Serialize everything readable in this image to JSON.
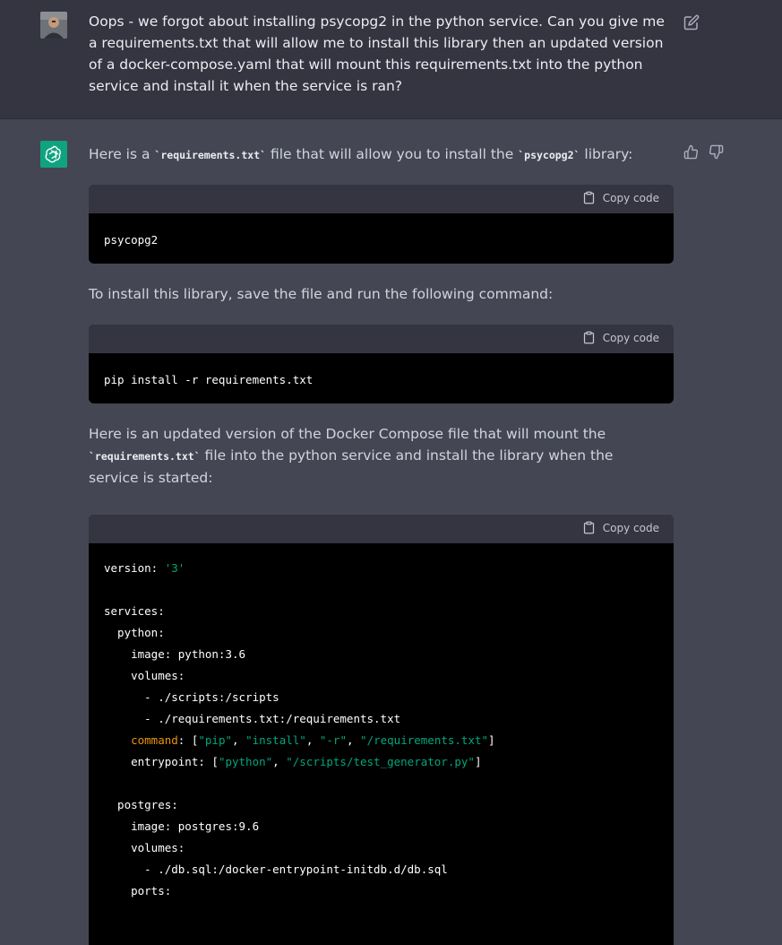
{
  "user_message": {
    "text": "Oops - we forgot about installing psycopg2 in the python service. Can you give me a requirements.txt that will allow me to install this library then an updated version of a docker-compose.yaml that will mount this requirements.txt into the python service and install it when the service is ran?"
  },
  "assistant": {
    "p1_before": "Here is a ",
    "p1_code1": "`requirements.txt`",
    "p1_middle": " file that will allow you to install the ",
    "p1_code2": "`psycopg2`",
    "p1_after": " library:",
    "code1": "psycopg2",
    "p2": "To install this library, save the file and run the following command:",
    "code2": "pip install -r requirements.txt",
    "p3_before": "Here is an updated version of the Docker Compose file that will mount the ",
    "p3_code": "`requirements.txt`",
    "p3_after": " file into the python service and install the library when the service is started:",
    "copy_label": "Copy code",
    "code3": {
      "l1_key": "version: ",
      "l1_val": "'3'",
      "l3": "services:",
      "l4": "  python:",
      "l5": "    image: python:3.6",
      "l6": "    volumes:",
      "l7": "      - ./scripts:/scripts",
      "l8": "      - ./requirements.txt:/requirements.txt",
      "l9_key": "command",
      "l9_colon": ": [",
      "l9_a": "\"pip\"",
      "l9_sep1": ", ",
      "l9_b": "\"install\"",
      "l9_sep2": ", ",
      "l9_c": "\"-r\"",
      "l9_sep3": ", ",
      "l9_d": "\"/requirements.txt\"",
      "l9_end": "]",
      "l10_key": "    entrypoint: [",
      "l10_a": "\"python\"",
      "l10_sep": ", ",
      "l10_b": "\"/scripts/test_generator.py\"",
      "l10_end": "]",
      "l12": "  postgres:",
      "l13": "    image: postgres:9.6",
      "l14": "    volumes:",
      "l15": "      - ./db.sql:/docker-entrypoint-initdb.d/db.sql",
      "l16": "    ports:"
    }
  },
  "colors": {
    "user_bg": "#343541",
    "assistant_bg": "#444654",
    "code_bg": "#000000",
    "code_header_bg": "#343541",
    "brand": "#10a37f",
    "string": "#00a67d",
    "keyword": "#df3079"
  }
}
